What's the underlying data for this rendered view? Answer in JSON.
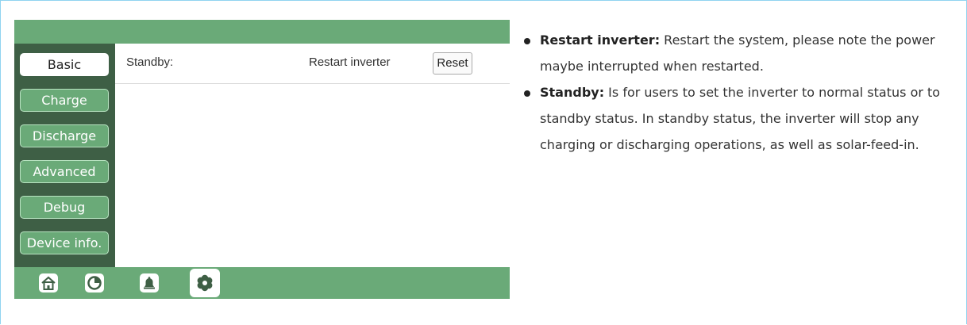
{
  "sidebar": {
    "items": [
      {
        "label": "Basic",
        "active": true
      },
      {
        "label": "Charge",
        "active": false
      },
      {
        "label": "Discharge",
        "active": false
      },
      {
        "label": "Advanced",
        "active": false
      },
      {
        "label": "Debug",
        "active": false
      },
      {
        "label": "Device info.",
        "active": false
      }
    ]
  },
  "content": {
    "row": {
      "label": "Standby:",
      "value": "Restart inverter",
      "button": "Reset"
    }
  },
  "bottom_nav": {
    "icons": [
      "home-icon",
      "chart-icon",
      "bell-icon",
      "gear-icon"
    ],
    "selected": "gear-icon"
  },
  "notes": {
    "items": [
      {
        "term": "Restart inverter:",
        "text": " Restart the system, please note the power maybe interrupted when restarted."
      },
      {
        "term": "Standby:",
        "text": " Is for users to set the inverter to normal status or to standby status. In standby status, the inverter will stop any charging or discharging operations, as well as solar-feed-in."
      }
    ]
  },
  "colors": {
    "screen_green": "#6aaa78",
    "sidebar_dark": "#3e5f45",
    "frame_border": "#8fd3f0"
  }
}
